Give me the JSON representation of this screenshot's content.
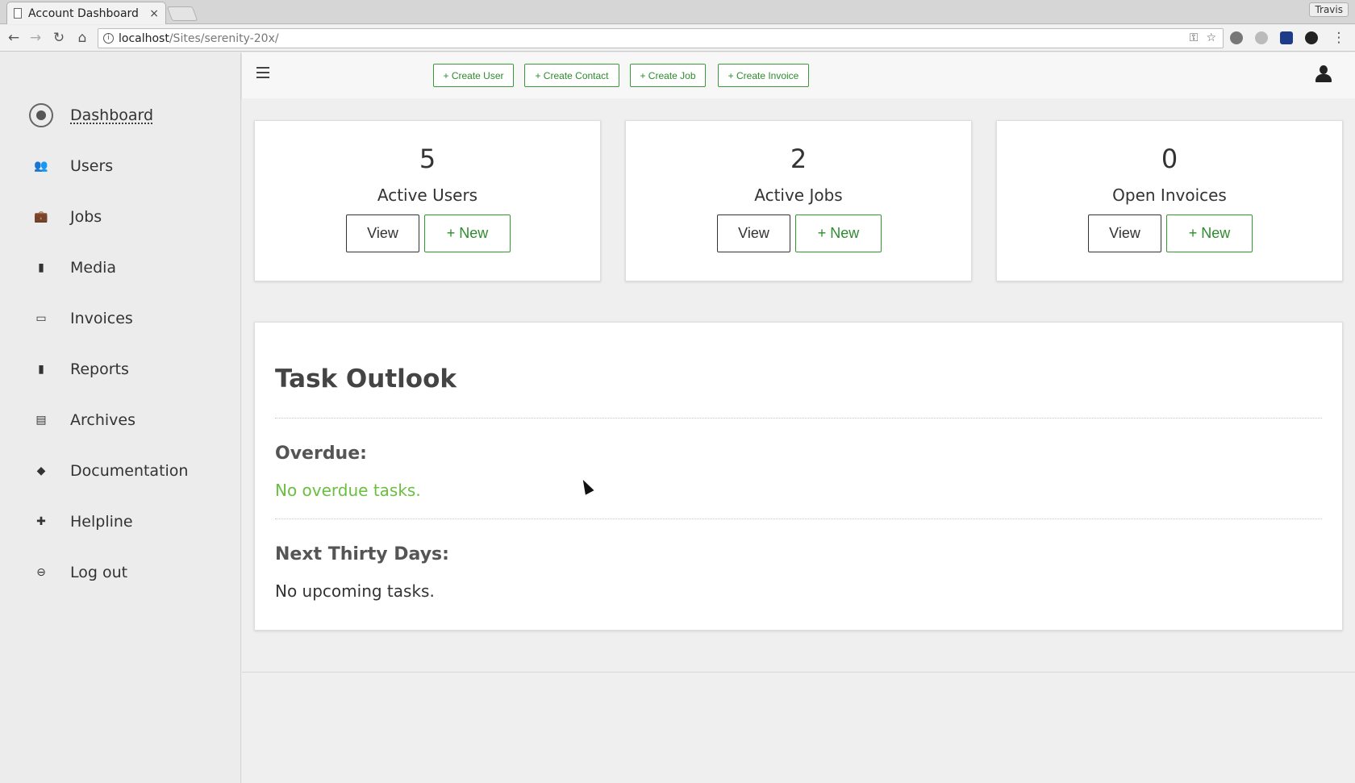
{
  "browser": {
    "tab_title": "Account Dashboard",
    "tab_close": "×",
    "profile_name": "Travis",
    "url_host": "localhost",
    "url_path": "/Sites/serenity-20x/",
    "back_glyph": "←",
    "forward_glyph": "→",
    "reload_glyph": "↻",
    "home_glyph": "⌂",
    "info_glyph": "i",
    "key_glyph": "⚿",
    "star_glyph": "☆",
    "menu_glyph": "⋮"
  },
  "sidebar": {
    "items": [
      {
        "label": "Dashboard",
        "icon": "dashboard-icon",
        "glyph": ""
      },
      {
        "label": "Users",
        "icon": "users-icon",
        "glyph": "👥"
      },
      {
        "label": "Jobs",
        "icon": "briefcase-icon",
        "glyph": "💼"
      },
      {
        "label": "Media",
        "icon": "file-icon",
        "glyph": "▮"
      },
      {
        "label": "Invoices",
        "icon": "money-icon",
        "glyph": "▭"
      },
      {
        "label": "Reports",
        "icon": "bar-chart-icon",
        "glyph": "▮"
      },
      {
        "label": "Archives",
        "icon": "clipboard-icon",
        "glyph": "▤"
      },
      {
        "label": "Documentation",
        "icon": "graduation-cap-icon",
        "glyph": "◆"
      },
      {
        "label": "Helpline",
        "icon": "medkit-icon",
        "glyph": "✚"
      },
      {
        "label": "Log out",
        "icon": "logout-icon",
        "glyph": "⊖"
      }
    ]
  },
  "topbar": {
    "create_user": "+ Create User",
    "create_contact": "+ Create Contact",
    "create_job": "+ Create Job",
    "create_invoice": "+ Create Invoice"
  },
  "stats": [
    {
      "value": "5",
      "label": "Active Users",
      "view": "View",
      "new": "+ New"
    },
    {
      "value": "2",
      "label": "Active Jobs",
      "view": "View",
      "new": "+ New"
    },
    {
      "value": "0",
      "label": "Open Invoices",
      "view": "View",
      "new": "+ New"
    }
  ],
  "tasks": {
    "title": "Task Outlook",
    "overdue_heading": "Overdue:",
    "overdue_msg": "No overdue tasks.",
    "next_heading": "Next Thirty Days:",
    "next_msg": "No upcoming tasks."
  },
  "colors": {
    "accent_green": "#2e8b2e",
    "overdue_green": "#6abf3f"
  }
}
